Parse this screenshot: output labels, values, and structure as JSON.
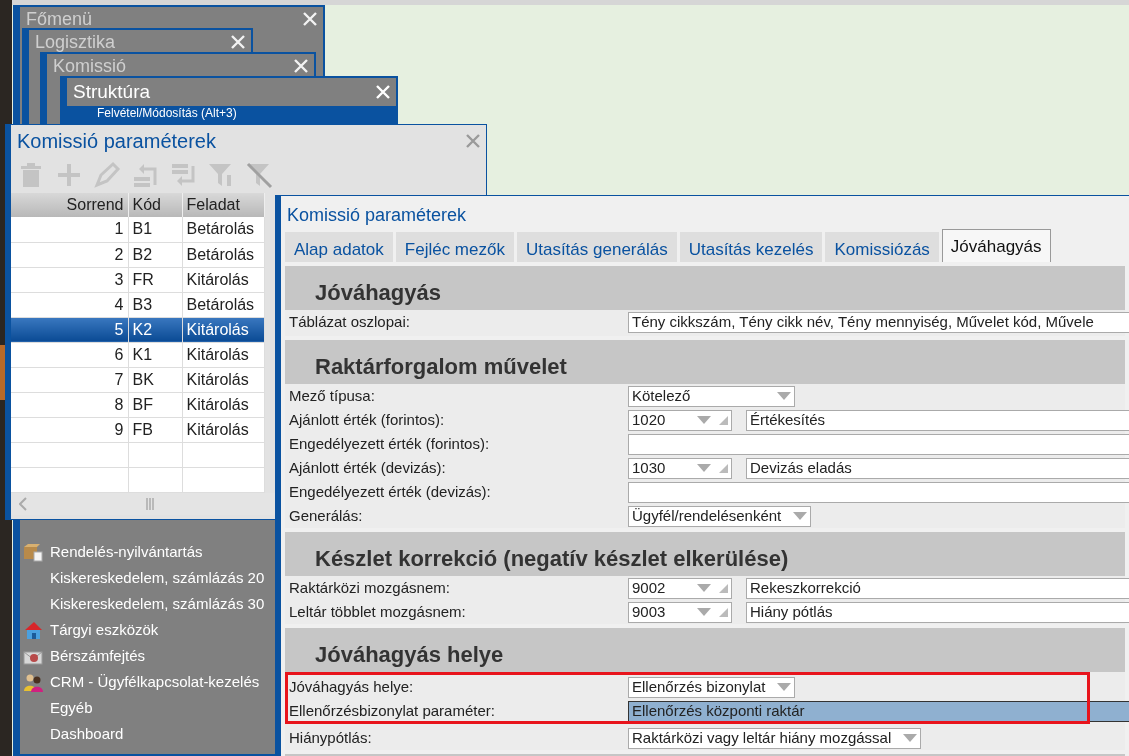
{
  "menu_windows": [
    {
      "title": "Főmenü",
      "active": false
    },
    {
      "title": "Logisztika",
      "active": false
    },
    {
      "title": "Komissió",
      "active": false
    },
    {
      "title": "Struktúra",
      "active": true,
      "item": "Felvétel/Módosítás (Alt+3)"
    }
  ],
  "main_menu_items": [
    {
      "label": "Rendelés-nyilvántartás",
      "kind": "box"
    },
    {
      "label": "Kiskereskedelem, számlázás 20",
      "kind": "plain"
    },
    {
      "label": "Kiskereskedelem, számlázás 30",
      "kind": "plain"
    },
    {
      "label": "Tárgyi eszközök",
      "kind": "house"
    },
    {
      "label": "Bérszámfejtés",
      "kind": "envelope"
    },
    {
      "label": "CRM - Ügyfélkapcsolat-kezelés",
      "kind": "people"
    },
    {
      "label": "Egyéb",
      "kind": "plain"
    },
    {
      "label": "Dashboard",
      "kind": "plain"
    }
  ],
  "list_window": {
    "title": "Komissió paraméterek",
    "toolbar": [
      {
        "kind": "delete",
        "disabled": true
      },
      {
        "kind": "add",
        "disabled": true
      },
      {
        "kind": "edit",
        "disabled": true
      },
      {
        "kind": "move-up",
        "disabled": true
      },
      {
        "kind": "move-down",
        "disabled": true
      },
      {
        "kind": "filter",
        "disabled": true
      },
      {
        "kind": "clear-filter",
        "disabled": true
      }
    ],
    "columns": [
      "Sorrend",
      "Kód",
      "Feladat"
    ],
    "rows": [
      {
        "cells": [
          "1",
          "B1",
          "Betárolás"
        ],
        "selected": false
      },
      {
        "cells": [
          "2",
          "B2",
          "Betárolás"
        ],
        "selected": false
      },
      {
        "cells": [
          "3",
          "FR",
          "Kitárolás"
        ],
        "selected": false
      },
      {
        "cells": [
          "4",
          "B3",
          "Betárolás"
        ],
        "selected": false
      },
      {
        "cells": [
          "5",
          "K2",
          "Kitárolás"
        ],
        "selected": true
      },
      {
        "cells": [
          "6",
          "K1",
          "Kitárolás"
        ],
        "selected": false
      },
      {
        "cells": [
          "7",
          "BK",
          "Kitárolás"
        ],
        "selected": false
      },
      {
        "cells": [
          "8",
          "BF",
          "Kitárolás"
        ],
        "selected": false
      },
      {
        "cells": [
          "9",
          "FB",
          "Kitárolás"
        ],
        "selected": false
      }
    ]
  },
  "detail_window": {
    "title": "Komissió paraméterek",
    "tabs": [
      {
        "label": "Alap adatok",
        "selected": false
      },
      {
        "label": "Fejléc mezők",
        "selected": false
      },
      {
        "label": "Utasítás generálás",
        "selected": false
      },
      {
        "label": "Utasítás kezelés",
        "selected": false
      },
      {
        "label": "Komissiózás",
        "selected": false
      },
      {
        "label": "Jóváhagyás",
        "selected": true
      }
    ],
    "sections": [
      {
        "title": "Jóváhagyás",
        "rows": [
          {
            "label": "Táblázat oszlopai:",
            "kind": "text",
            "value": "Tény cikkszám, Tény cikk név, Tény mennyiség, Művelet kód, Művele"
          }
        ]
      },
      {
        "title": "Raktárforgalom művelet",
        "rows": [
          {
            "label": "Mező típusa:",
            "kind": "select",
            "value": "Kötelező"
          },
          {
            "label": "Ajánlott érték (forintos):",
            "kind": "lookup",
            "code": "1020",
            "name": "Értékesítés"
          },
          {
            "label": "Engedélyezett érték (forintos):",
            "kind": "text"
          },
          {
            "label": "Ajánlott érték (devizás):",
            "kind": "lookup",
            "code": "1030",
            "name": "Devizás eladás"
          },
          {
            "label": "Engedélyezett érték (devizás):",
            "kind": "text"
          },
          {
            "label": "Generálás:",
            "kind": "select",
            "value": "Ügyfél/rendelésenként"
          }
        ]
      },
      {
        "title": "Készlet korrekció (negatív készlet elkerülése)",
        "rows": [
          {
            "label": "Raktárközi mozgásnem:",
            "kind": "lookup",
            "code": "9002",
            "name": "Rekeszkorrekció"
          },
          {
            "label": "Leltár többlet mozgásnem:",
            "kind": "lookup",
            "code": "9003",
            "name": "Hiány pótlás"
          }
        ]
      },
      {
        "title": "Jóváhagyás helye",
        "rows": [
          {
            "label": "Jóváhagyás helye:",
            "kind": "select",
            "value": "Ellenőrzés bizonylat",
            "highlighted": true
          },
          {
            "label": "Ellenőrzésbizonylat paraméter:",
            "kind": "text",
            "value": "Ellenőrzés központi raktár",
            "highlighted": true,
            "focused": true
          },
          {
            "label": "Hiánypótlás:",
            "kind": "select",
            "value": "Raktárközi vagy leltár hiány mozgással",
            "highlighted": false
          }
        ]
      }
    ]
  }
}
